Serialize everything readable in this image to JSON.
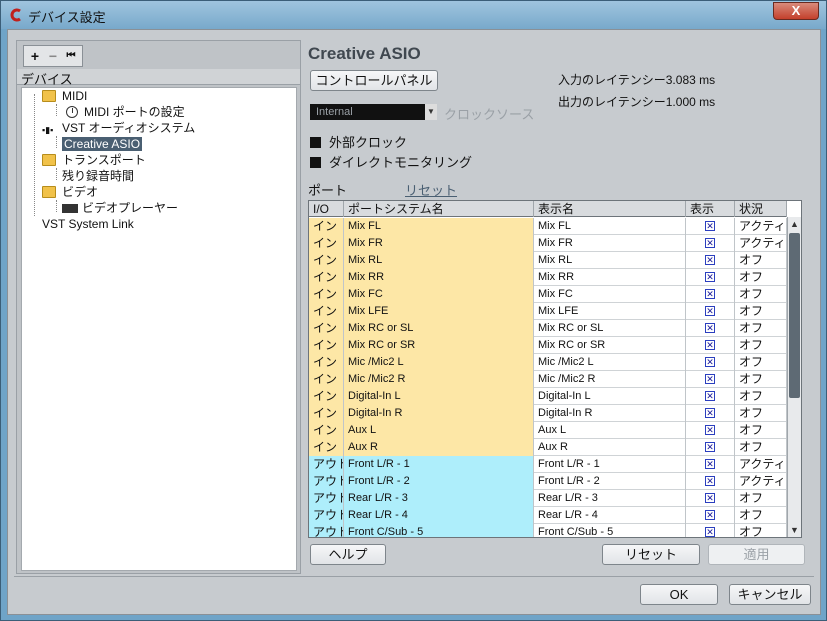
{
  "window": {
    "title": "デバイス設定",
    "close_label": "X"
  },
  "toolbar": {
    "add": "+",
    "remove": "−",
    "reset": "⏮"
  },
  "tree": {
    "header": "デバイス",
    "items": [
      {
        "label": "MIDI",
        "icon": "folder-icon"
      },
      {
        "label": "MIDI ポートの設定",
        "icon": "clock-icon"
      },
      {
        "label": "VST オーディオシステム",
        "icon": "vst-icon"
      },
      {
        "label": "Creative ASIO",
        "icon": ""
      },
      {
        "label": "トランスポート",
        "icon": "folder-icon"
      },
      {
        "label": "残り録音時間",
        "icon": ""
      },
      {
        "label": "ビデオ",
        "icon": "folder-icon"
      },
      {
        "label": "ビデオプレーヤー",
        "icon": "video-icon"
      },
      {
        "label": "VST System Link",
        "icon": ""
      }
    ]
  },
  "panel": {
    "title": "Creative ASIO",
    "control_panel_button": "コントロールパネル",
    "input_latency": "入力のレイテンシー3.083 ms",
    "output_latency": "出力のレイテンシー1.000 ms",
    "clock_select_value": "Internal",
    "clock_source_label": "クロックソース",
    "external_clock_label": "外部クロック",
    "direct_monitoring_label": "ダイレクトモニタリング",
    "ports_label": "ポート",
    "reset_link": "リセット"
  },
  "table": {
    "headers": [
      "I/O",
      "ポートシステム名",
      "表示名",
      "表示",
      "状況"
    ],
    "rows": [
      {
        "io": "イン",
        "system": "Mix FL",
        "display": "Mix FL",
        "show": "✕",
        "state": "アクティブ"
      },
      {
        "io": "イン",
        "system": "Mix FR",
        "display": "Mix FR",
        "show": "✕",
        "state": "アクティブ"
      },
      {
        "io": "イン",
        "system": "Mix RL",
        "display": "Mix RL",
        "show": "✕",
        "state": "オフ"
      },
      {
        "io": "イン",
        "system": "Mix RR",
        "display": "Mix RR",
        "show": "✕",
        "state": "オフ"
      },
      {
        "io": "イン",
        "system": "Mix FC",
        "display": "Mix FC",
        "show": "✕",
        "state": "オフ"
      },
      {
        "io": "イン",
        "system": "Mix LFE",
        "display": "Mix LFE",
        "show": "✕",
        "state": "オフ"
      },
      {
        "io": "イン",
        "system": "Mix RC or SL",
        "display": "Mix RC or SL",
        "show": "✕",
        "state": "オフ"
      },
      {
        "io": "イン",
        "system": "Mix RC or SR",
        "display": "Mix RC or SR",
        "show": "✕",
        "state": "オフ"
      },
      {
        "io": "イン",
        "system": "Mic /Mic2 L",
        "display": "Mic /Mic2 L",
        "show": "✕",
        "state": "オフ"
      },
      {
        "io": "イン",
        "system": "Mic /Mic2 R",
        "display": "Mic /Mic2 R",
        "show": "✕",
        "state": "オフ"
      },
      {
        "io": "イン",
        "system": "Digital-In L",
        "display": "Digital-In L",
        "show": "✕",
        "state": "オフ"
      },
      {
        "io": "イン",
        "system": "Digital-In R",
        "display": "Digital-In R",
        "show": "✕",
        "state": "オフ"
      },
      {
        "io": "イン",
        "system": "Aux L",
        "display": "Aux L",
        "show": "✕",
        "state": "オフ"
      },
      {
        "io": "イン",
        "system": "Aux R",
        "display": "Aux R",
        "show": "✕",
        "state": "オフ"
      },
      {
        "io": "アウト",
        "system": "Front L/R - 1",
        "display": "Front L/R - 1",
        "show": "✕",
        "state": "アクティブ"
      },
      {
        "io": "アウト",
        "system": "Front L/R - 2",
        "display": "Front L/R - 2",
        "show": "✕",
        "state": "アクティブ"
      },
      {
        "io": "アウト",
        "system": "Rear L/R - 3",
        "display": "Rear L/R - 3",
        "show": "✕",
        "state": "オフ"
      },
      {
        "io": "アウト",
        "system": "Rear L/R - 4",
        "display": "Rear L/R - 4",
        "show": "✕",
        "state": "オフ"
      },
      {
        "io": "アウト",
        "system": "Front C/Sub - 5",
        "display": "Front C/Sub - 5",
        "show": "✕",
        "state": "オフ"
      }
    ]
  },
  "buttons": {
    "help": "ヘルプ",
    "reset": "リセット",
    "apply": "適用",
    "ok": "OK",
    "cancel": "キャンセル"
  },
  "colors": {
    "input_row": "#fde7a6",
    "output_row": "#aeeefb"
  }
}
